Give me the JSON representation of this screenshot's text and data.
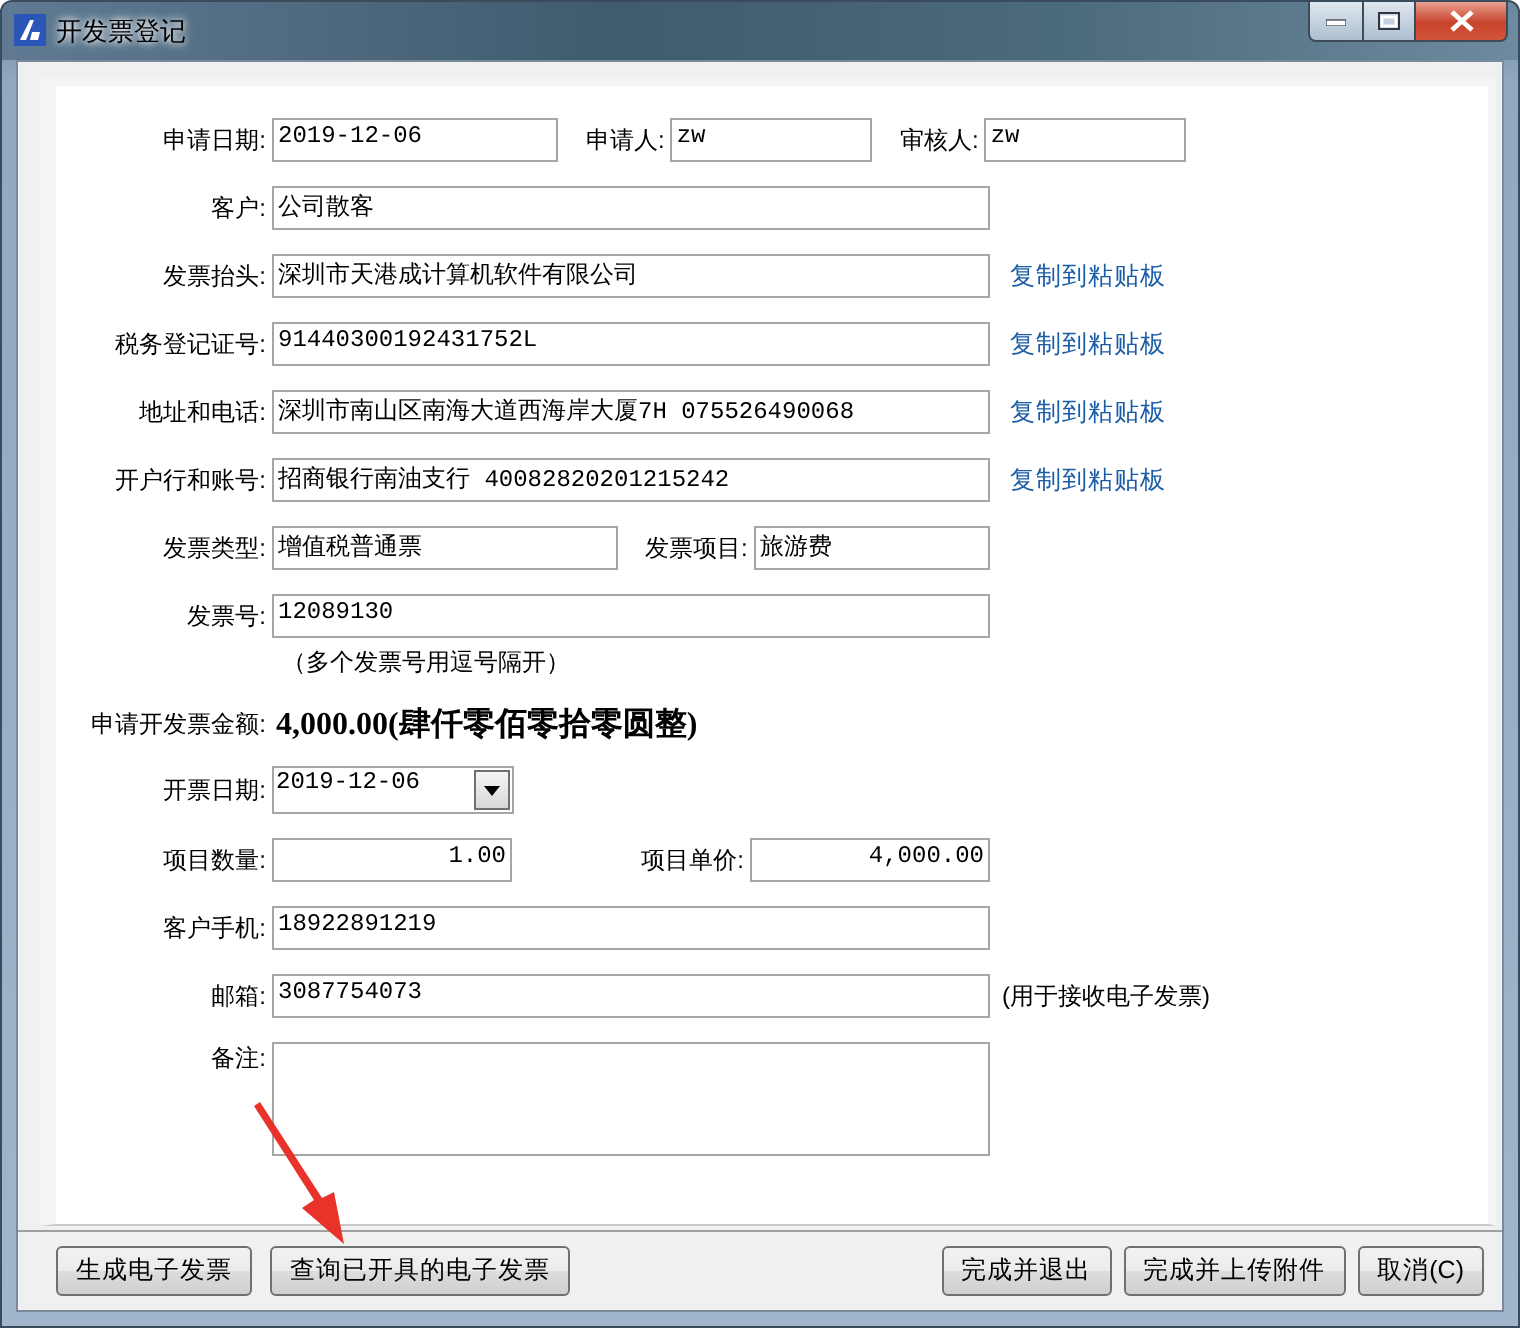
{
  "window": {
    "title": "开发票登记"
  },
  "rows": [
    {
      "kind": "fields",
      "items": [
        {
          "kind": "short",
          "label": "申请日期:",
          "value": "2019-12-06"
        },
        {
          "kind": "short",
          "label": "申请人:",
          "value": "zw"
        },
        {
          "kind": "short",
          "label": "审核人:",
          "value": "zw"
        }
      ]
    },
    {
      "kind": "fields",
      "items": [
        {
          "kind": "text",
          "label": "客户:",
          "value": "公司散客"
        }
      ]
    },
    {
      "kind": "fields",
      "items": [
        {
          "kind": "text",
          "label": "发票抬头:",
          "value": "深圳市天港成计算机软件有限公司"
        }
      ],
      "link": "复制到粘贴板"
    },
    {
      "kind": "fields",
      "items": [
        {
          "kind": "text",
          "label": "税务登记证号:",
          "value": "91440300192431752L"
        }
      ],
      "link": "复制到粘贴板"
    },
    {
      "kind": "fields",
      "items": [
        {
          "kind": "text",
          "label": "地址和电话:",
          "value": "深圳市南山区南海大道西海岸大厦7H 075526490068"
        }
      ],
      "link": "复制到粘贴板"
    },
    {
      "kind": "fields",
      "items": [
        {
          "kind": "text",
          "label": "开户行和账号:",
          "value": "招商银行南油支行 40082820201215242"
        }
      ],
      "link": "复制到粘贴板"
    },
    {
      "kind": "fields",
      "items": [
        {
          "kind": "short",
          "label": "发票类型:",
          "value": "增值税普通票"
        },
        {
          "kind": "short",
          "label": "发票项目:",
          "value": "旅游费"
        }
      ]
    },
    {
      "kind": "fields",
      "items": [
        {
          "kind": "text",
          "label": "发票号:",
          "value": "12089130"
        }
      ]
    },
    {
      "kind": "note",
      "text": "（多个发票号用逗号隔开）"
    },
    {
      "kind": "amount",
      "label": "申请开发票金额:",
      "value": "4,000.00(肆仟零佰零拾零圆整)"
    },
    {
      "kind": "fields",
      "items": [
        {
          "kind": "date",
          "label": "开票日期:",
          "value": "2019-12-06"
        }
      ]
    },
    {
      "kind": "fields",
      "items": [
        {
          "kind": "number",
          "label": "项目数量:",
          "value": "1.00"
        },
        {
          "kind": "number",
          "label": "项目单价:",
          "value": "4,000.00"
        }
      ]
    },
    {
      "kind": "fields",
      "items": [
        {
          "kind": "text",
          "label": "客户手机:",
          "value": "18922891219"
        }
      ]
    },
    {
      "kind": "fields",
      "items": [
        {
          "kind": "text",
          "label": "邮箱:",
          "value": "3087754073"
        }
      ],
      "note": "(用于接收电子发票)"
    },
    {
      "kind": "fields",
      "items": [
        {
          "kind": "memo",
          "label": "备注:"
        }
      ]
    }
  ],
  "buttons_left": [
    "生成电子发票",
    "查询已开具的电子发票"
  ],
  "buttons_right": [
    "完成并退出",
    "完成并上传附件",
    "取消(C)"
  ]
}
